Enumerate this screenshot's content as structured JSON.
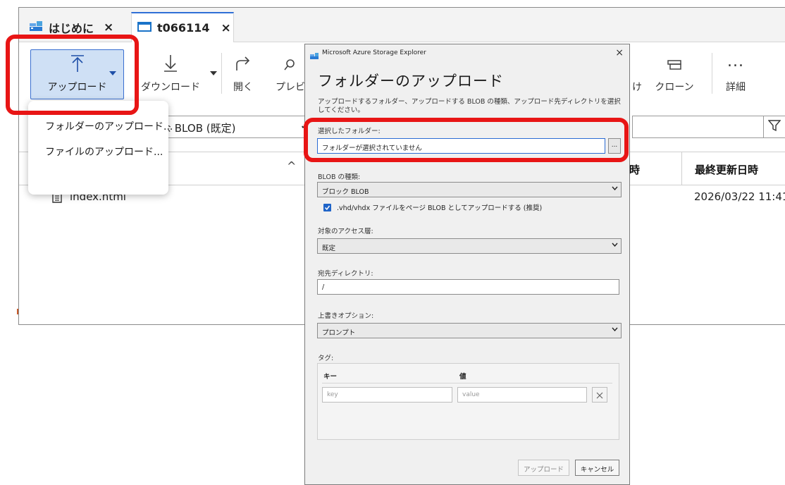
{
  "tabs": [
    {
      "label": "はじめに",
      "close": "×",
      "icon": "azure-app-icon"
    },
    {
      "label": "t066114",
      "close": "×",
      "icon": "storage-container-icon"
    }
  ],
  "toolbar": {
    "upload_label": "アップロード",
    "download_label": "ダウンロード",
    "open_label": "開く",
    "preview_label": "プレビ",
    "attach_label": "け",
    "clone_label": "クローン",
    "more_label": "詳細",
    "more_glyph": "..."
  },
  "filter": {
    "blob_select_value": "ブな BLOB (既定)",
    "chevron": "✓"
  },
  "list": {
    "col_access_tail": "時",
    "col_modified": "最終更新日時",
    "sort_glyph": "^",
    "rows": [
      {
        "name": "index.html",
        "modified": "2026/03/22 11:41"
      }
    ]
  },
  "upload_menu": {
    "items": [
      "フォルダーのアップロード...",
      "ファイルのアップロード..."
    ]
  },
  "dialog": {
    "app_title": "Microsoft Azure Storage Explorer",
    "close": "×",
    "heading": "フォルダーのアップロード",
    "description": "アップロードするフォルダー、アップロードする BLOB の種類、アップロード先ディレクトリを選択してください。",
    "selected_folder_label": "選択したフォルダー:",
    "selected_folder_value": "フォルダーが選択されていません",
    "browse_label": "...",
    "blob_type_label": "BLOB の種類:",
    "blob_type_value": "ブロック BLOB",
    "vhd_checkbox_label": ".vhd/vhdx ファイルをページ BLOB としてアップロードする (推奨)",
    "vhd_checked": true,
    "access_tier_label": "対象のアクセス層:",
    "access_tier_value": "既定",
    "dest_dir_label": "宛先ディレクトリ:",
    "dest_dir_value": "/",
    "overwrite_label": "上書きオプション:",
    "overwrite_value": "プロンプト",
    "tags_label": "タグ:",
    "tags_key_header": "キー",
    "tags_value_header": "値",
    "tag_key_placeholder": "key",
    "tag_value_placeholder": "value",
    "upload_button": "アップロード",
    "cancel_button": "キャンセル"
  },
  "colors": {
    "highlight": "#e81515",
    "accent": "#2f6fd6",
    "upload_button_bg": "#cfe0f5"
  }
}
